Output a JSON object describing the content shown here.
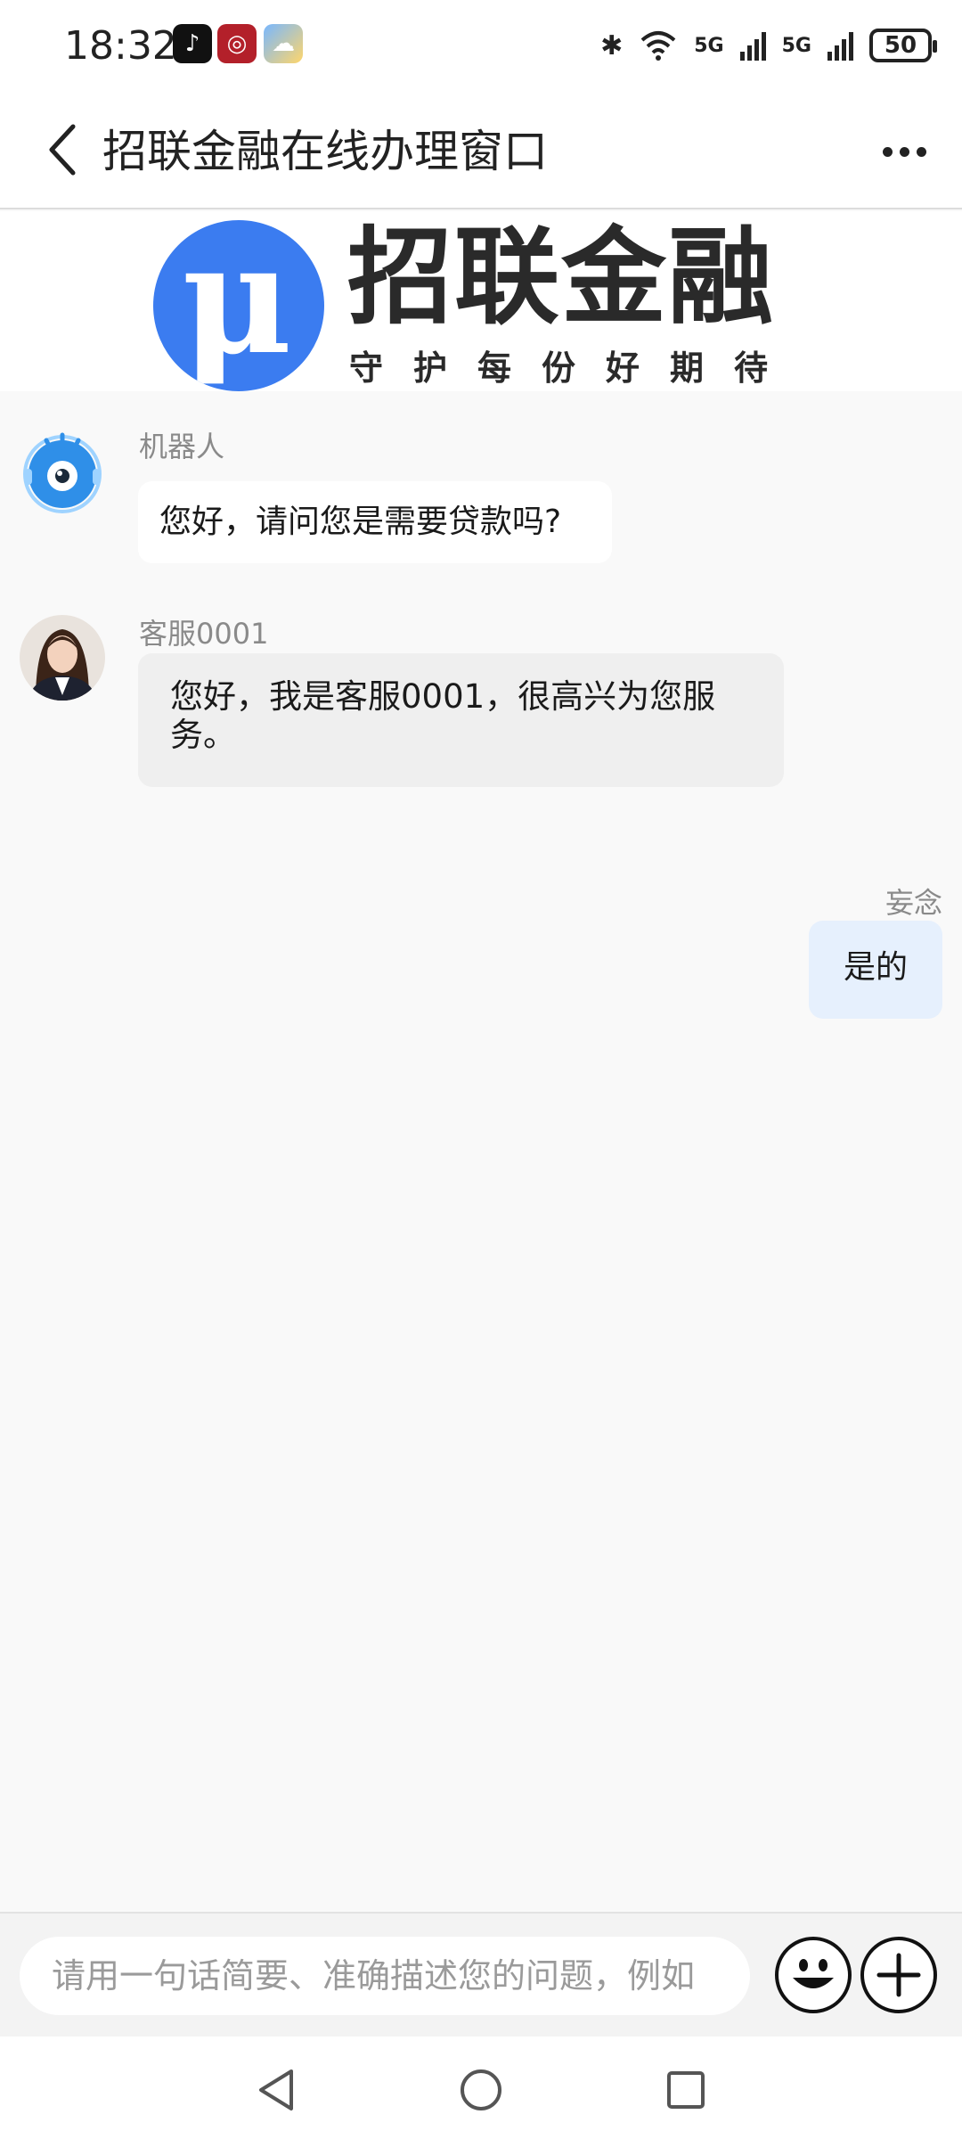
{
  "status_bar": {
    "time": "18:32",
    "apps": [
      "tiktok-icon",
      "bank-app-icon",
      "weather-app-icon"
    ],
    "network_1": "5G",
    "network_2": "5G",
    "battery": "50"
  },
  "header": {
    "title": "招联金融在线办理窗口",
    "back_icon": "chevron-left-icon",
    "more_icon": "more-dots-icon"
  },
  "banner": {
    "logo_glyph": "μ",
    "brand_name": "招联金融",
    "slogan": "守护每份好期待"
  },
  "chat": {
    "messages": [
      {
        "sender": "机器人",
        "text": "您好，请问您是需要贷款吗?",
        "side": "left",
        "avatar": "robot-avatar"
      },
      {
        "sender": "客服0001",
        "text": "您好，我是客服0001，很高兴为您服务。",
        "side": "left",
        "avatar": "agent-avatar"
      },
      {
        "sender": "妄念",
        "text": "是的",
        "side": "right"
      }
    ]
  },
  "input": {
    "placeholder": "请用一句话简要、准确描述您的问题，例如"
  },
  "colors": {
    "brand_blue": "#3b7cf0",
    "user_bubble": "#e6f0fd",
    "agent_bubble": "#efefef",
    "background": "#f9f9f9"
  }
}
